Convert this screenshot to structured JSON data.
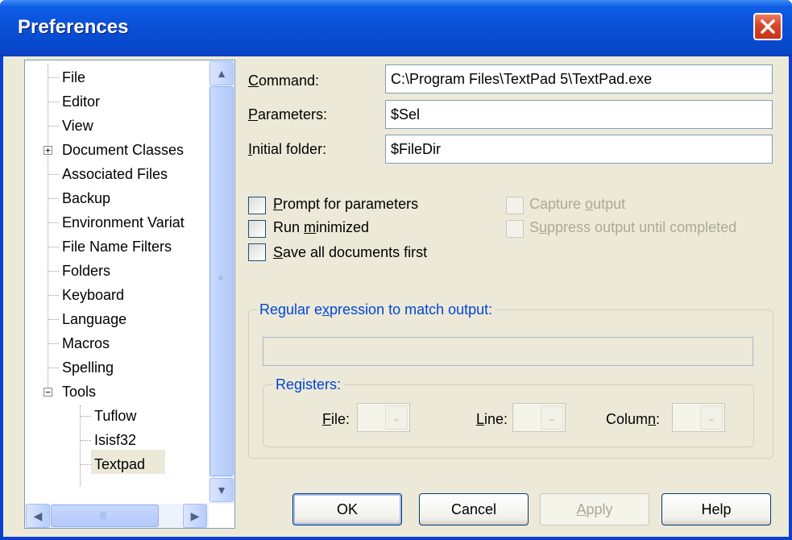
{
  "window": {
    "title": "Preferences"
  },
  "tree": {
    "items": [
      {
        "label": "File"
      },
      {
        "label": "Editor"
      },
      {
        "label": "View"
      },
      {
        "label": "Document Classes"
      },
      {
        "label": "Associated Files"
      },
      {
        "label": "Backup"
      },
      {
        "label": "Environment Variat"
      },
      {
        "label": "File Name Filters"
      },
      {
        "label": "Folders"
      },
      {
        "label": "Keyboard"
      },
      {
        "label": "Language"
      },
      {
        "label": "Macros"
      },
      {
        "label": "Spelling"
      },
      {
        "label": "Tools"
      },
      {
        "label": "Tuflow"
      },
      {
        "label": "Isisf32"
      },
      {
        "label": "Textpad"
      }
    ],
    "selected": "Textpad"
  },
  "form": {
    "command": {
      "label_u": "C",
      "label_rest": "ommand:",
      "value": "C:\\Program Files\\TextPad 5\\TextPad.exe"
    },
    "parameters": {
      "label_u": "P",
      "label_rest": "arameters:",
      "value": "$Sel"
    },
    "initial_folder": {
      "label_u": "I",
      "label_rest": "nitial folder:",
      "value": "$FileDir"
    }
  },
  "options": {
    "prompt": {
      "u": "P",
      "rest": "rompt for parameters",
      "checked": false
    },
    "run_min": {
      "pre": "Run ",
      "u": "m",
      "rest": "inimized",
      "checked": false
    },
    "save_all": {
      "u": "S",
      "rest": "ave all documents first",
      "checked": false
    },
    "capture": {
      "pre": "Capture ",
      "u": "o",
      "rest": "utput",
      "checked": false,
      "enabled": false
    },
    "suppress": {
      "pre": "S",
      "u": "u",
      "rest": "ppress output until completed",
      "checked": false,
      "enabled": false
    }
  },
  "regex": {
    "legend_pre": "Regular e",
    "legend_u": "x",
    "legend_rest": "pression to match output:",
    "value": ""
  },
  "registers": {
    "legend": "Registers:",
    "file": {
      "u": "F",
      "rest": "ile:"
    },
    "line": {
      "u": "L",
      "rest": "ine:"
    },
    "column": {
      "pre": "Colum",
      "u": "n",
      "rest": ":"
    }
  },
  "buttons": {
    "ok": "OK",
    "cancel": "Cancel",
    "apply_u": "A",
    "apply_rest": "pply",
    "help": "Help"
  },
  "icons": {
    "close": "close-icon",
    "expand": "plus-box-icon",
    "collapse": "minus-box-icon",
    "up": "scroll-up-icon",
    "down": "scroll-down-icon",
    "left": "scroll-left-icon",
    "right": "scroll-right-icon",
    "dropdown": "chevron-down-icon"
  }
}
